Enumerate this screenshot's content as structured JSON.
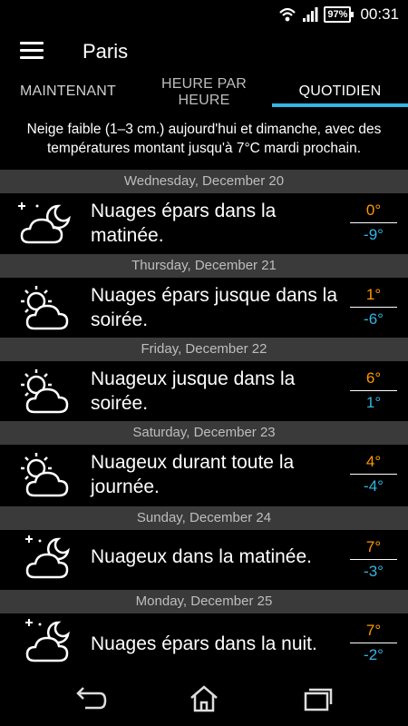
{
  "status_bar": {
    "battery": "97",
    "time": "00:31",
    "icons": [
      "wifi-icon",
      "signal-icon",
      "battery-icon"
    ]
  },
  "app_bar": {
    "menu_icon": "menu-icon",
    "city": "Paris"
  },
  "tabs": [
    {
      "label": "MAINTENANT",
      "selected": false
    },
    {
      "label": "HEURE PAR HEURE",
      "selected": false
    },
    {
      "label": "QUOTIDIEN",
      "selected": true
    }
  ],
  "summary": "Neige faible (1–3 cm.) aujourd'hui et dimanche, avec des températures montant jusqu'à 7°C mardi prochain.",
  "days": [
    {
      "date": "Wednesday, December 20",
      "icon": "partly-cloudy-night-icon",
      "description": "Nuages épars dans la matinée.",
      "high": "0°",
      "low": "-9°"
    },
    {
      "date": "Thursday, December 21",
      "icon": "partly-cloudy-day-icon",
      "description": "Nuages épars jusque dans la soirée.",
      "high": "1°",
      "low": "-6°"
    },
    {
      "date": "Friday, December 22",
      "icon": "partly-cloudy-day-icon",
      "description": "Nuageux jusque dans la soirée.",
      "high": "6°",
      "low": "1°"
    },
    {
      "date": "Saturday, December 23",
      "icon": "partly-cloudy-day-icon",
      "description": "Nuageux durant toute la journée.",
      "high": "4°",
      "low": "-4°"
    },
    {
      "date": "Sunday, December 24",
      "icon": "partly-cloudy-night-icon",
      "description": "Nuageux dans la matinée.",
      "high": "7°",
      "low": "-3°"
    },
    {
      "date": "Monday, December 25",
      "icon": "partly-cloudy-night-icon",
      "description": "Nuages épars dans la nuit.",
      "high": "7°",
      "low": "-2°"
    }
  ],
  "colors": {
    "background": "#000000",
    "accent": "#33b5e5",
    "high_temp": "#ff9900",
    "low_temp": "#33b5e5",
    "day_header_bg": "#3a3a3a"
  },
  "nav_bar": {
    "icons": [
      "back-icon",
      "home-icon",
      "recents-icon"
    ]
  }
}
